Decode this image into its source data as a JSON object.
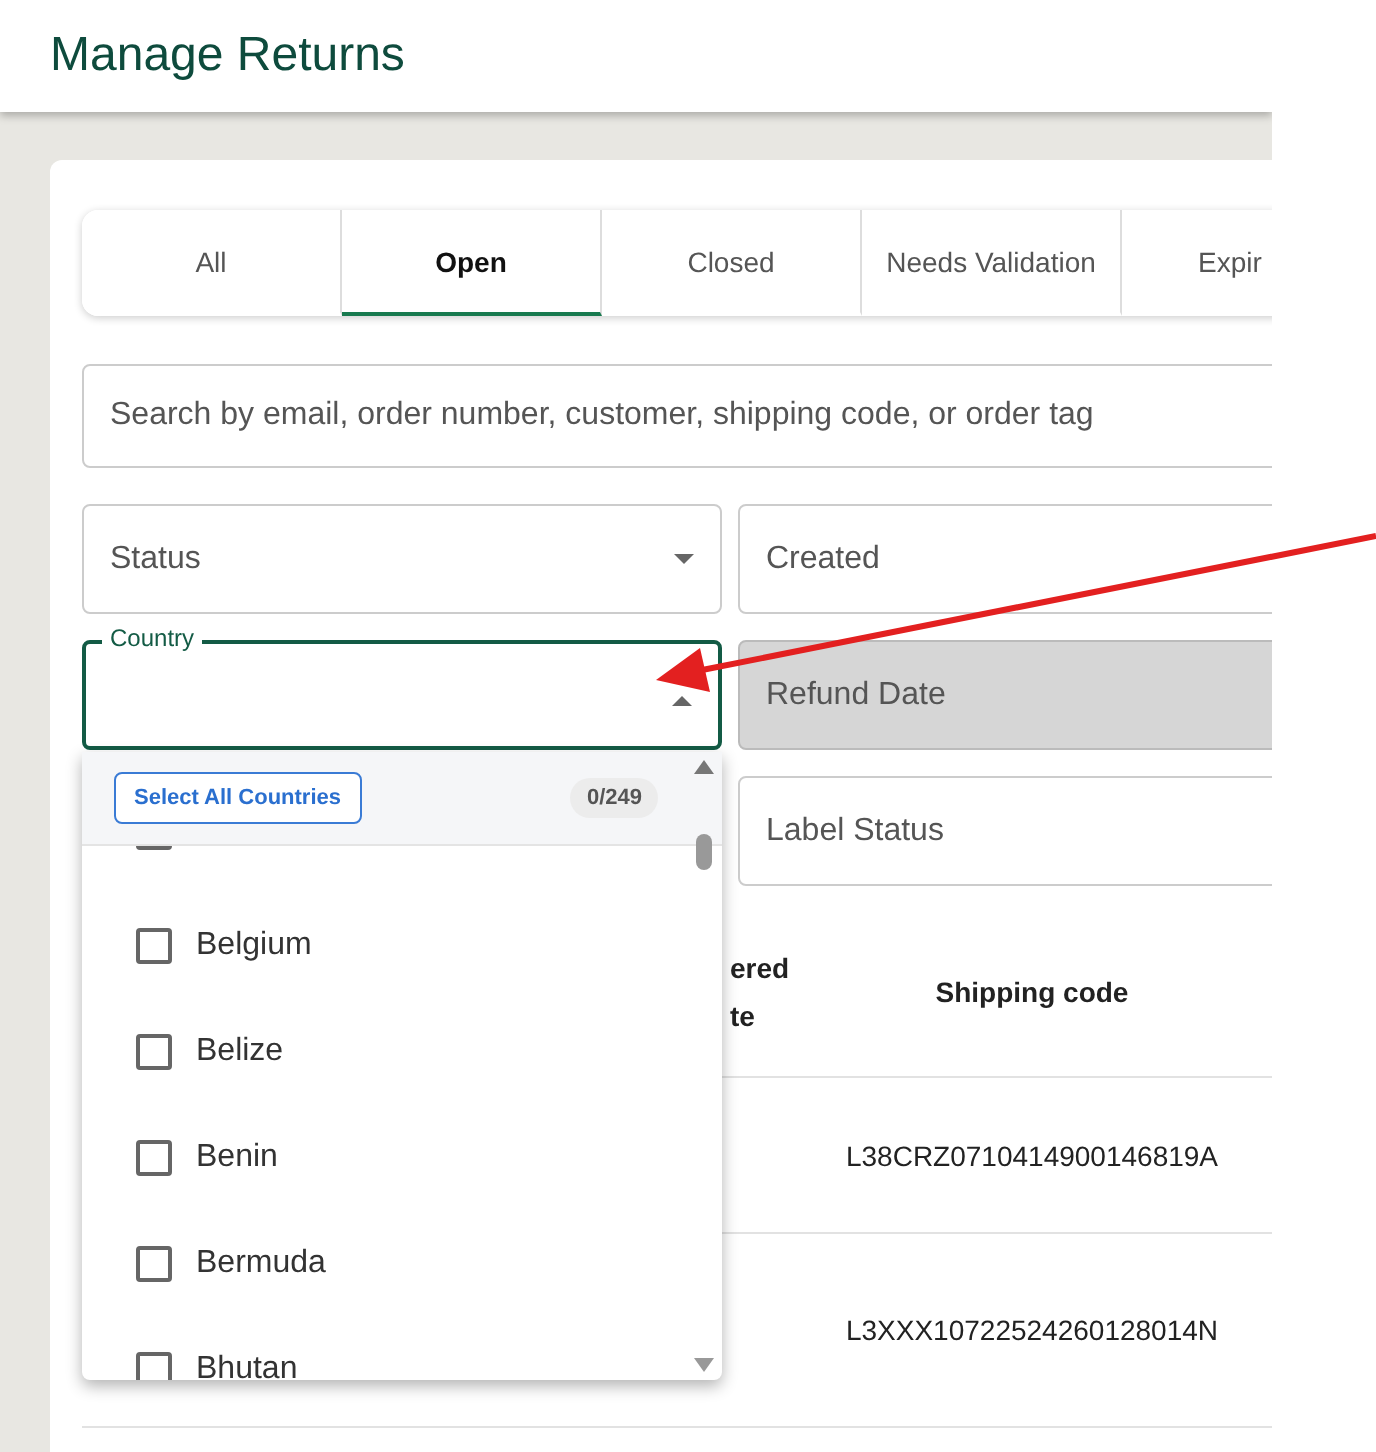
{
  "header": {
    "title": "Manage Returns"
  },
  "tabs": [
    {
      "label": "All",
      "selected": false
    },
    {
      "label": "Open",
      "selected": true
    },
    {
      "label": "Closed",
      "selected": false
    },
    {
      "label": "Needs Validation",
      "selected": false
    },
    {
      "label": "Expir",
      "selected": false
    }
  ],
  "search": {
    "placeholder": "Search by email, order number, customer, shipping code, or order tag"
  },
  "filters": [
    {
      "label": "Status",
      "kind": "select",
      "disabled": false
    },
    {
      "label": "Created",
      "kind": "plain",
      "disabled": false
    },
    {
      "label": "Country",
      "kind": "open",
      "disabled": false
    },
    {
      "label": "Refund Date",
      "kind": "plain",
      "disabled": true
    },
    {
      "label": "Label Status",
      "kind": "plain",
      "disabled": false
    }
  ],
  "country_dropdown": {
    "select_all": "Select All Countries",
    "count": "0/249",
    "options": [
      {
        "label": "Belgium",
        "checked": false
      },
      {
        "label": "Belize",
        "checked": false
      },
      {
        "label": "Benin",
        "checked": false
      },
      {
        "label": "Bermuda",
        "checked": false
      },
      {
        "label": "Bhutan",
        "checked": false
      }
    ]
  },
  "table": {
    "columns": [
      {
        "lines": [
          "ered",
          "te"
        ]
      },
      {
        "lines": [
          "Shipping code"
        ]
      }
    ],
    "rows": [
      {
        "shipping_code": "L38CRZ0710414900146819A"
      },
      {
        "shipping_code": "L3XXX10722524260128014N"
      }
    ]
  }
}
